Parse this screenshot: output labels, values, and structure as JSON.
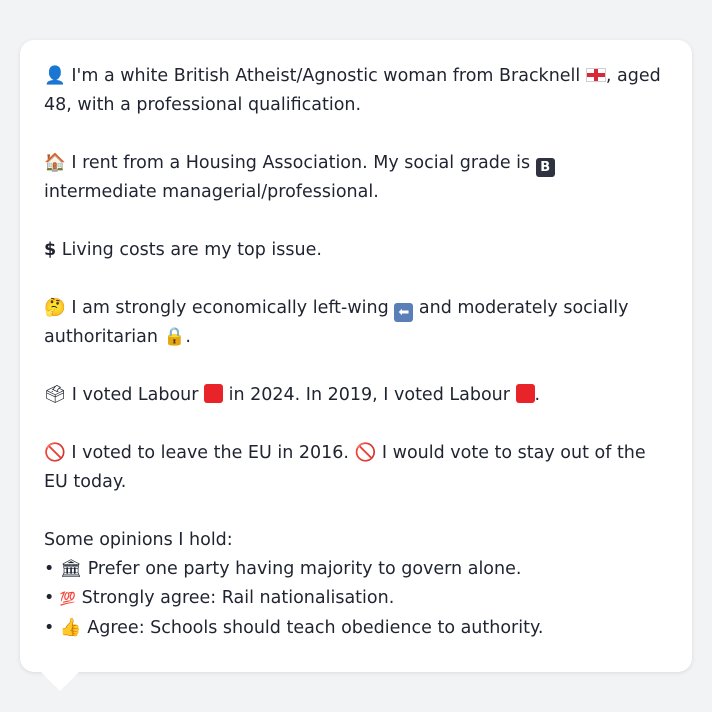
{
  "profile": {
    "p1": {
      "icon": "person-silhouette-icon",
      "text_a": "I'm a white British Atheist/Agnostic woman from Bracknell",
      "flag_icon": "england-flag-icon",
      "text_b": ", aged 48, with a professional qualification."
    },
    "p2": {
      "icon": "house-icon",
      "text_a": "I rent from a Housing Association. My social grade is",
      "badge": "B",
      "text_b": "intermediate managerial/professional."
    },
    "p3": {
      "icon": "dollar-sign-icon",
      "text": "Living costs are my top issue."
    },
    "p4": {
      "icon": "thinking-face-icon",
      "text_a": "I am strongly economically left-wing",
      "left_arrow_icon": "left-arrow-icon",
      "text_b": "and moderately socially authoritarian",
      "lock_icon": "lock-icon",
      "text_c": "."
    },
    "p5": {
      "icon": "ballot-box-icon",
      "text_a": "I voted Labour",
      "text_b": "in 2024. In 2019, I voted Labour",
      "text_c": ".",
      "party_color": "#e8232a"
    },
    "p6": {
      "icon": "no-entry-icon",
      "text_a": "I voted to leave the EU in 2016.",
      "text_b": "I would vote to stay out of the EU today."
    },
    "opinions": {
      "heading": "Some opinions I hold:",
      "items": [
        {
          "icon": "classical-building-icon",
          "text": "Prefer one party having majority to govern alone."
        },
        {
          "icon": "hundred-points-icon",
          "text": "Strongly agree: Rail nationalisation."
        },
        {
          "icon": "thumbs-up-icon",
          "text": "Agree: Schools should teach obedience to authority."
        }
      ]
    }
  }
}
